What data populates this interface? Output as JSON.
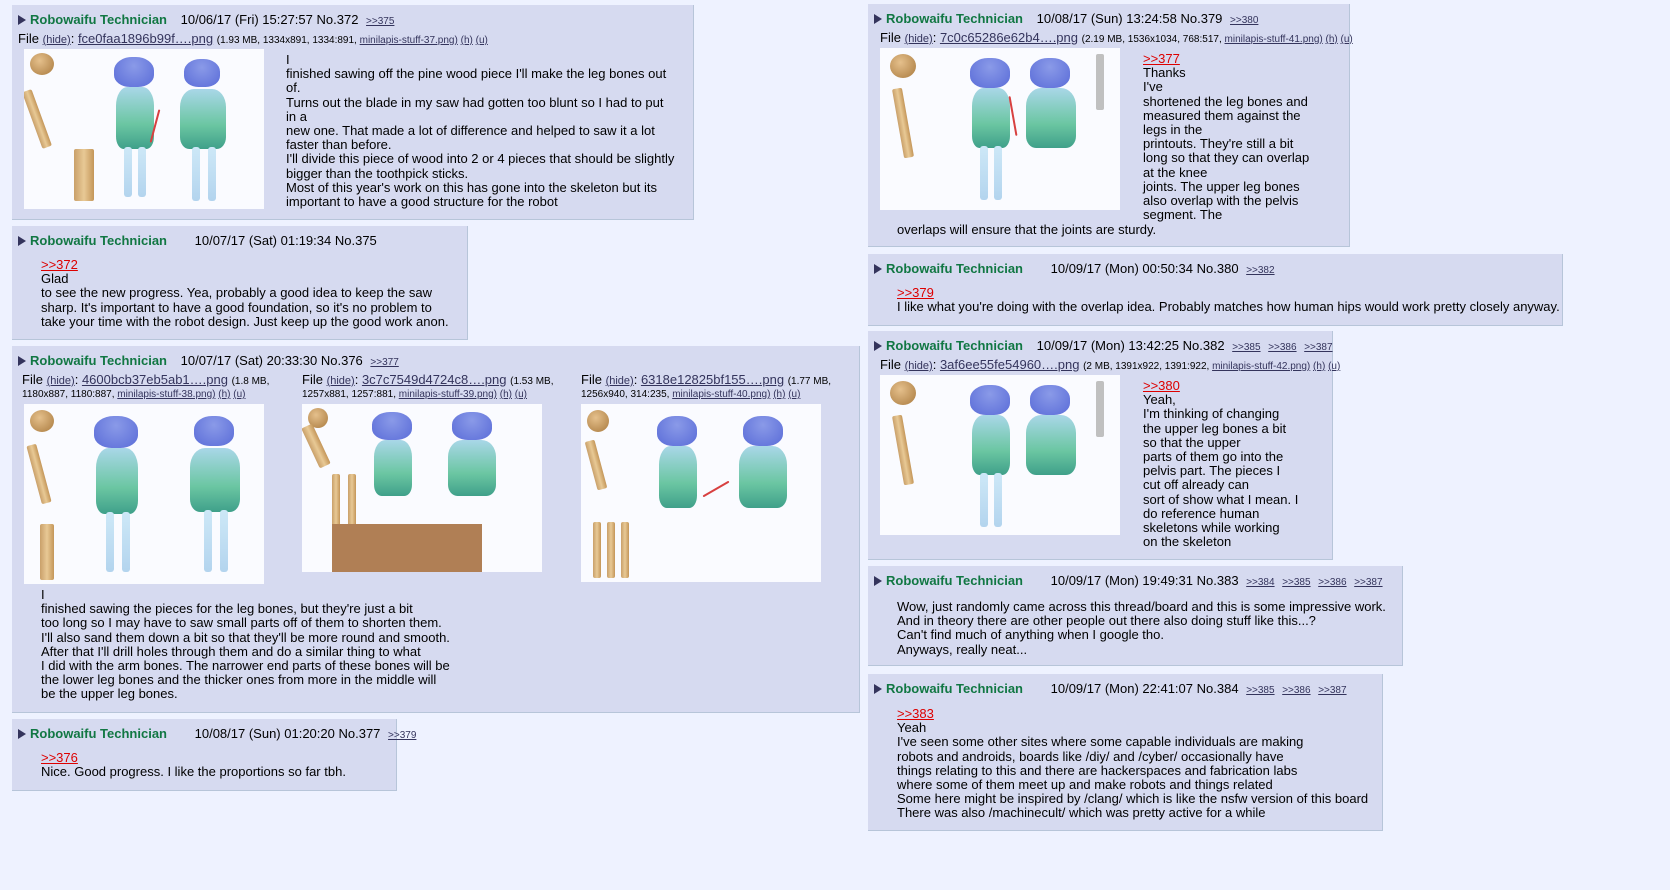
{
  "posts": {
    "p372": {
      "name": "Robowaifu Technician",
      "date": "10/06/17 (Fri) 15:27:57",
      "no": "No.372",
      "backlinks": [
        ">>375"
      ],
      "file": {
        "label": "File",
        "hide": "(hide)",
        "filename": "fce0faa1896b99f….png",
        "meta": "(1.93 MB, 1334x891, 1334:891,",
        "orig": "minilapis-stuff-37.png)",
        "h": "(h)",
        "u": "(u)"
      },
      "lines": [
        "I",
        " finished sawing off the pine wood piece I'll make the leg bones out",
        "of.",
        " Turns out the blade in my saw had gotten too blunt so I had to put",
        "in a",
        " new one. That made a lot of difference and helped to saw it a lot",
        "faster than before.",
        "I'll divide this piece of wood into 2 or 4 pieces that should be slightly",
        "bigger than the toothpick sticks.",
        "Most of this year's work on this has gone into the skeleton but its",
        "important to have a good structure for the robot"
      ]
    },
    "p375": {
      "name": "Robowaifu Technician",
      "date": "10/07/17 (Sat) 01:19:34",
      "no": "No.375",
      "quote": ">>372",
      "lines": [
        "Glad",
        " to see the new progress. Yea, probably a good idea to keep the saw",
        "sharp. It's important to have a good foundation, so it's no problem to",
        "take your time with the robot design. Just keep up the good work anon."
      ]
    },
    "p376": {
      "name": "Robowaifu Technician",
      "date": "10/07/17 (Sat) 20:33:30",
      "no": "No.376",
      "backlinks": [
        ">>377"
      ],
      "files": [
        {
          "label": "File",
          "hide": "(hide)",
          "filename": "4600bcb37eb5ab1….png",
          "meta1": "(1.8 MB,",
          "meta2": "1180x887, 1180:887,",
          "orig": "minilapis-stuff-38.png)",
          "h": "(h)",
          "u": "(u)"
        },
        {
          "label": "File",
          "hide": "(hide)",
          "filename": "3c7c7549d4724c8….png",
          "meta1": "(1.53 MB,",
          "meta2": "1257x881, 1257:881,",
          "orig": "minilapis-stuff-39.png)",
          "h": "(h)",
          "u": "(u)"
        },
        {
          "label": "File",
          "hide": "(hide)",
          "filename": "6318e12825bf155….png",
          "meta1": "(1.77 MB,",
          "meta2": "1256x940, 314:235,",
          "orig": "minilapis-stuff-40.png)",
          "h": "(h)",
          "u": "(u)"
        }
      ],
      "lines": [
        "I",
        " finished sawing the pieces for the leg bones, but they're just a bit",
        "too long so I may have to saw small parts off of them to shorten them.",
        "I'll also sand them down a bit so that they'll be more round and smooth.",
        " After that I'll drill holes through them and do a similar thing to what",
        " I did with the arm bones. The narrower end parts of these bones will be",
        " the lower leg bones and the thicker ones from more in the middle will",
        "be the upper leg bones."
      ]
    },
    "p377": {
      "name": "Robowaifu Technician",
      "date": "10/08/17 (Sun) 01:20:20",
      "no": "No.377",
      "backlinks": [
        ">>379"
      ],
      "quote": ">>376",
      "lines": [
        "Nice. Good progress. I like the proportions so far tbh."
      ]
    },
    "p379": {
      "name": "Robowaifu Technician",
      "date": "10/08/17 (Sun) 13:24:58",
      "no": "No.379",
      "backlinks": [
        ">>380"
      ],
      "file": {
        "label": "File",
        "hide": "(hide)",
        "filename": "7c0c65286e62b4….png",
        "meta": "(2.19 MB, 1536x1034, 768:517,",
        "orig": "minilapis-stuff-41.png)",
        "h": "(h)",
        "u": "(u)"
      },
      "quote": ">>377",
      "lines": [
        "Thanks",
        "I've",
        " shortened the leg bones and",
        "measured them against the",
        "legs in the",
        "printouts. They're still a bit",
        "long so that they can overlap",
        "at the knee",
        " joints. The upper leg bones",
        "also overlap with the pelvis",
        "segment. The"
      ],
      "tail": "overlaps will ensure that the joints are sturdy."
    },
    "p380": {
      "name": "Robowaifu Technician",
      "date": "10/09/17 (Mon) 00:50:34",
      "no": "No.380",
      "backlinks": [
        ">>382"
      ],
      "quote": ">>379",
      "lines": [
        "I like what you're doing with the overlap idea. Probably matches how human hips would work pretty closely anyway."
      ]
    },
    "p382": {
      "name": "Robowaifu Technician",
      "date": "10/09/17 (Mon) 13:42:25",
      "no": "No.382",
      "backlinks": [
        ">>385",
        ">>386",
        ">>387"
      ],
      "file": {
        "label": "File",
        "hide": "(hide)",
        "filename": "3af6ee55fe54960….png",
        "meta": "(2 MB, 1391x922, 1391:922,",
        "orig": "minilapis-stuff-42.png)",
        "h": "(h)",
        "u": "(u)"
      },
      "quote": ">>380",
      "lines": [
        "Yeah,",
        " I'm thinking of changing",
        "the upper leg bones a bit",
        "so that the upper",
        "parts of them go into the",
        "pelvis part. The pieces I",
        "cut off already can",
        "sort of show what I mean. I",
        "do reference human",
        "skeletons while working",
        "on the skeleton"
      ]
    },
    "p383": {
      "name": "Robowaifu Technician",
      "date": "10/09/17 (Mon) 19:49:31",
      "no": "No.383",
      "backlinks": [
        ">>384",
        ">>385",
        ">>386",
        ">>387"
      ],
      "lines": [
        "Wow, just randomly came across this thread/board and this is some impressive work.",
        "And in theory there are other people out there also doing stuff like this...?",
        "Can't find much of anything when I google tho.",
        "Anyways, really neat..."
      ]
    },
    "p384": {
      "name": "Robowaifu Technician",
      "date": "10/09/17 (Mon) 22:41:07",
      "no": "No.384",
      "backlinks": [
        ">>385",
        ">>386",
        ">>387"
      ],
      "quote": ">>383",
      "lines": [
        "Yeah",
        " I've seen some other sites where some capable individuals are making",
        "robots and androids, boards like /diy/ and /cyber/ occasionally have",
        "things relating to this and there are hackerspaces and fabrication labs",
        "where some of them meet up and make robots and things related",
        "Some here might be inspired by /clang/ which is like the nsfw version of this board",
        "There was also /machinecult/ which was pretty active for a while"
      ]
    }
  }
}
